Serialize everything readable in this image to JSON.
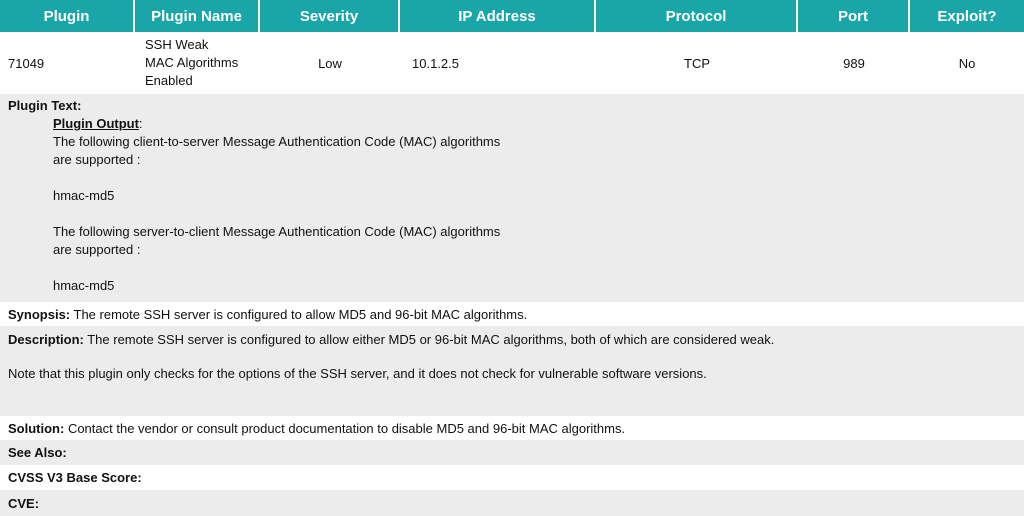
{
  "headers": [
    "Plugin",
    "Plugin Name",
    "Severity",
    "IP Address",
    "Protocol",
    "Port",
    "Exploit?"
  ],
  "row": {
    "plugin": "71049",
    "name": "SSH Weak\nMAC Algorithms\nEnabled",
    "severity": "Low",
    "ip": "10.1.2.5",
    "protocol": "TCP",
    "port": "989",
    "exploit": "No"
  },
  "plugin_text": {
    "label": "Plugin Text:",
    "output_label": "Plugin Output",
    "lines": [
      "The following client-to-server Message Authentication Code (MAC) algorithms",
      "are supported :",
      "",
      "hmac-md5",
      "",
      "The following server-to-client Message Authentication Code (MAC) algorithms",
      "are supported :",
      "",
      "hmac-md5"
    ]
  },
  "synopsis": {
    "label": "Synopsis:",
    "text": " The remote SSH server is configured to allow MD5 and 96-bit MAC algorithms."
  },
  "description": {
    "label": "Description:",
    "text": " The remote SSH server is configured to allow either MD5 or 96-bit MAC algorithms, both of which are considered weak.",
    "note": "Note that this plugin only checks for the options of the SSH server, and it does not check for vulnerable software versions."
  },
  "solution": {
    "label": "Solution:",
    "text": " Contact the vendor or consult product documentation to disable MD5 and 96-bit MAC algorithms."
  },
  "see_also": {
    "label": "See Also:"
  },
  "cvss": {
    "label": "CVSS V3 Base Score:"
  },
  "cve": {
    "label": "CVE:"
  }
}
